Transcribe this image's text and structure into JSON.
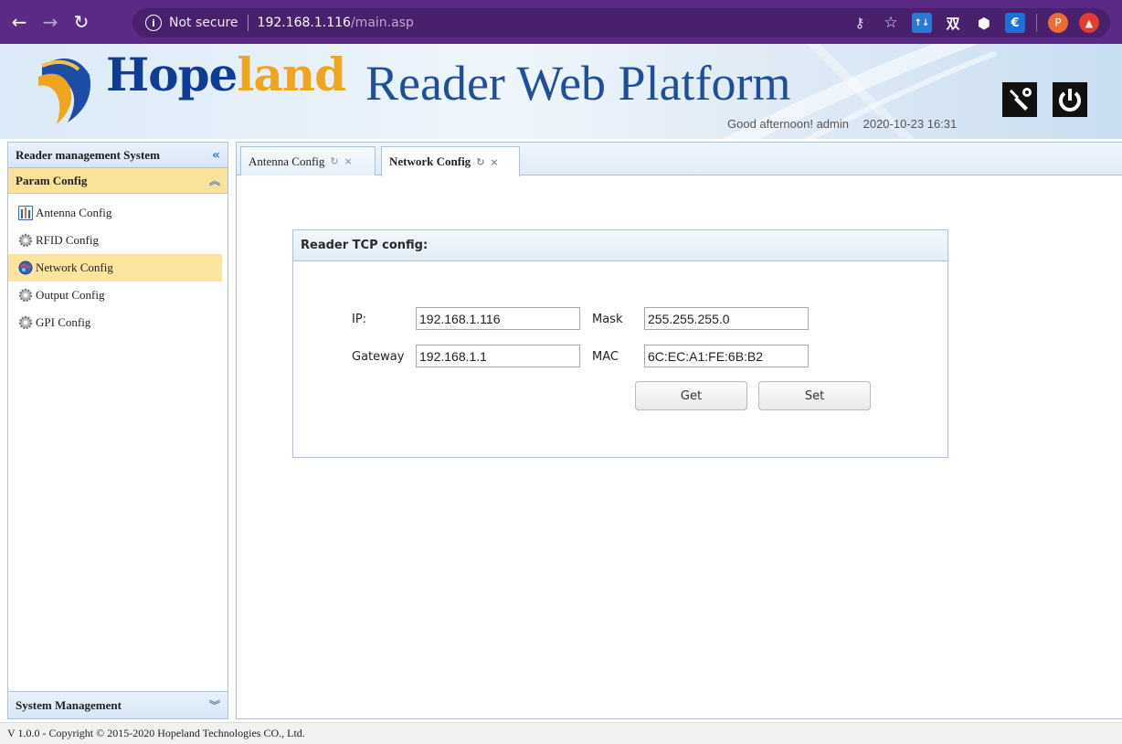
{
  "browser": {
    "security_label": "Not secure",
    "url_host": "192.168.1.116",
    "url_path": "/main.asp",
    "extensions": [
      {
        "icon": "key-icon"
      },
      {
        "icon": "star-icon"
      },
      {
        "icon": "translate-icon",
        "label": "↑↓"
      },
      {
        "icon": "cn-dictionary-icon",
        "label": "双"
      },
      {
        "icon": "cube-icon"
      },
      {
        "icon": "euro-icon",
        "label": "€"
      },
      {
        "icon": "profile-avatar",
        "label": "P"
      },
      {
        "icon": "update-icon"
      }
    ]
  },
  "header": {
    "logo_main": "Hope",
    "logo_tail": "land",
    "title": "Reader Web Platform",
    "greeting": "Good afternoon! admin",
    "datetime": "2020-10-23 16:31",
    "colors": {
      "logo_blue": "#0f3d93",
      "logo_orange": "#f0a51e",
      "title_blue": "#1f4f9b"
    }
  },
  "sidebar": {
    "title": "Reader management System",
    "group": "Param Config",
    "items": [
      {
        "label": "Antenna Config",
        "icon": "antenna-icon"
      },
      {
        "label": "RFID Config",
        "icon": "gear-icon"
      },
      {
        "label": "Network Config",
        "icon": "network-globe-icon",
        "active": true
      },
      {
        "label": "Output Config",
        "icon": "gear-icon"
      },
      {
        "label": "GPI Config",
        "icon": "gear-icon"
      }
    ],
    "footer": "System Management"
  },
  "tabs": [
    {
      "label": "Antenna Config",
      "active": false
    },
    {
      "label": "Network Config",
      "active": true
    }
  ],
  "form": {
    "title": "Reader TCP config:",
    "ip_label": "IP:",
    "ip_value": "192.168.1.116",
    "mask_label": "Mask",
    "mask_value": "255.255.255.0",
    "gateway_label": "Gateway",
    "gateway_value": "192.168.1.1",
    "mac_label": "MAC",
    "mac_value": "6C:EC:A1:FE:6B:B2",
    "get_label": "Get",
    "set_label": "Set"
  },
  "status": {
    "text": "V 1.0.0 - Copyright © 2015-2020 Hopeland Technologies CO., Ltd."
  }
}
